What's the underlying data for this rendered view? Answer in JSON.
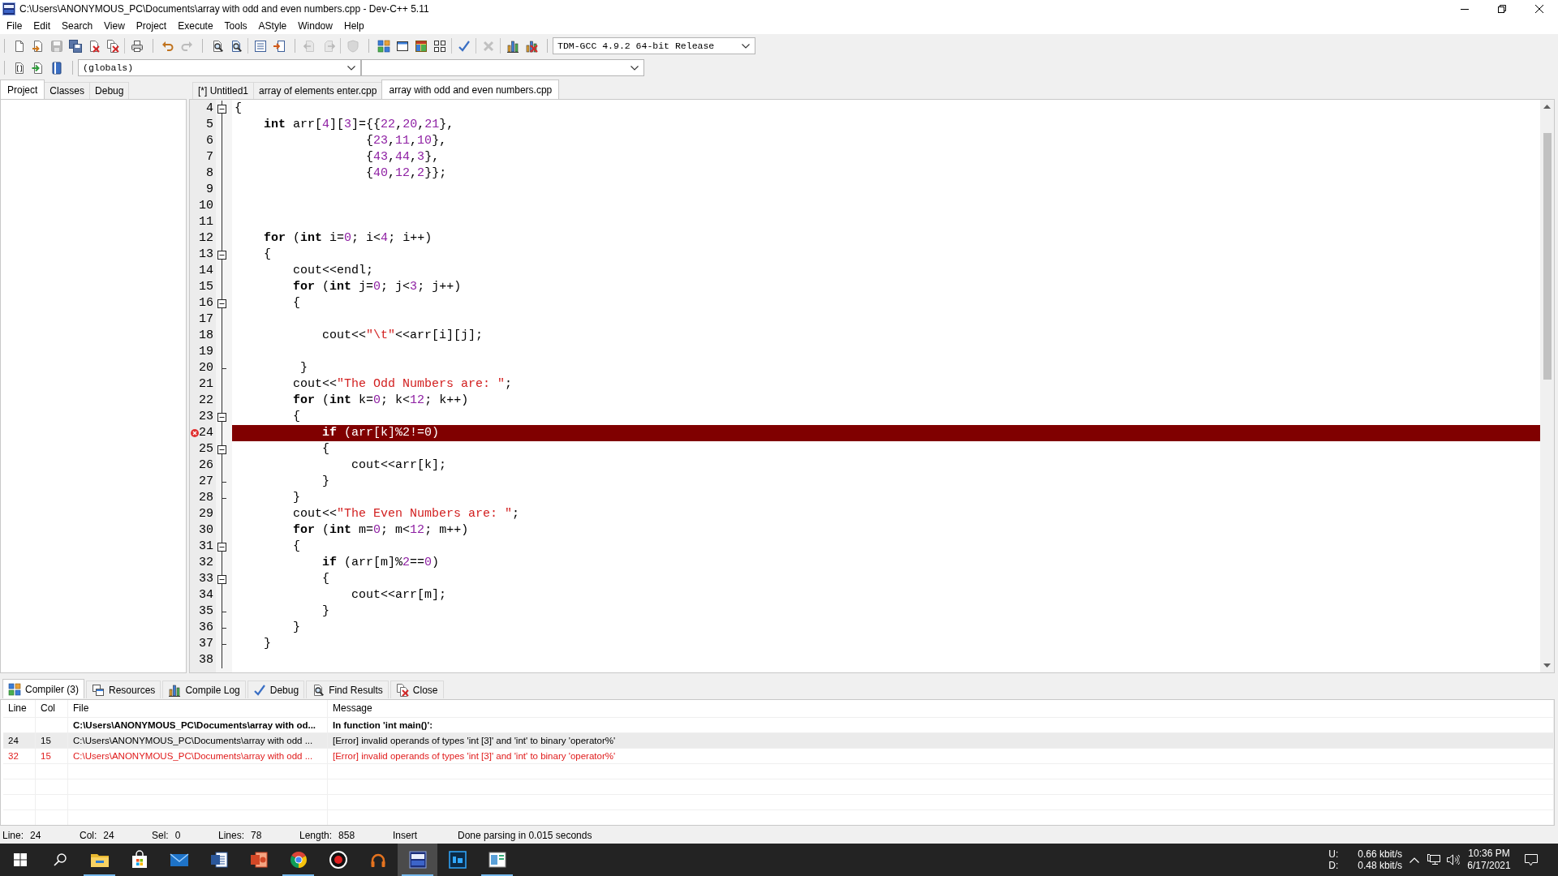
{
  "window": {
    "title": "C:\\Users\\ANONYMOUS_PC\\Documents\\array with odd and even numbers.cpp - Dev-C++ 5.11"
  },
  "menu": [
    "File",
    "Edit",
    "Search",
    "View",
    "Project",
    "Execute",
    "Tools",
    "AStyle",
    "Window",
    "Help"
  ],
  "toolbar": {
    "bands": [
      {
        "groups": [
          [
            {
              "kind": "new",
              "disabled": false
            },
            {
              "kind": "open",
              "disabled": false
            },
            {
              "kind": "save",
              "disabled": true
            },
            {
              "kind": "saveall",
              "disabled": false
            },
            {
              "kind": "close",
              "disabled": false
            },
            {
              "kind": "closeall",
              "disabled": false
            }
          ],
          [
            {
              "kind": "print",
              "disabled": false
            }
          ]
        ]
      },
      {
        "groups": [
          [
            {
              "kind": "undo",
              "disabled": false
            },
            {
              "kind": "redo",
              "disabled": true
            }
          ]
        ]
      },
      {
        "groups": [
          [
            {
              "kind": "find",
              "disabled": false
            },
            {
              "kind": "replace",
              "disabled": false
            }
          ],
          [
            {
              "kind": "panel",
              "disabled": false
            },
            {
              "kind": "panelarrow",
              "disabled": false
            }
          ]
        ]
      },
      {
        "groups": [
          [
            {
              "kind": "back",
              "disabled": true
            },
            {
              "kind": "forward",
              "disabled": true
            }
          ],
          [
            {
              "kind": "shield",
              "disabled": true
            }
          ]
        ]
      },
      {
        "groups": [
          [
            {
              "kind": "compile",
              "disabled": false
            },
            {
              "kind": "run",
              "disabled": false
            },
            {
              "kind": "compilerun",
              "disabled": false
            },
            {
              "kind": "rebuild",
              "disabled": false
            }
          ],
          [
            {
              "kind": "check",
              "disabled": false
            }
          ],
          [
            {
              "kind": "stop",
              "disabled": true
            }
          ],
          [
            {
              "kind": "profile",
              "disabled": false
            },
            {
              "kind": "deleteprofile",
              "disabled": false
            }
          ]
        ]
      }
    ],
    "compiler": "TDM-GCC 4.9.2 64-bit Release"
  },
  "classbar": {
    "buttons": [
      {
        "kind": "insertclass"
      },
      {
        "kind": "gotoclass"
      },
      {
        "kind": "bookmark"
      }
    ],
    "scope": "(globals)"
  },
  "left_panel": {
    "tabs": [
      {
        "label": "Project",
        "selected": true
      },
      {
        "label": "Classes",
        "selected": false
      },
      {
        "label": "Debug",
        "selected": false
      }
    ]
  },
  "editor": {
    "tabs": [
      {
        "label": "[*] Untitled1",
        "selected": false
      },
      {
        "label": "array of elements enter.cpp",
        "selected": false
      },
      {
        "label": "array with odd and even numbers.cpp",
        "selected": true
      }
    ],
    "lines": [
      {
        "number": "4",
        "foldable": true,
        "block_end": false,
        "error": false,
        "tokens": [
          {
            "kind": "plain",
            "text": "{"
          }
        ]
      },
      {
        "number": "5",
        "foldable": false,
        "block_end": false,
        "error": false,
        "tokens": [
          {
            "kind": "keyword",
            "text": "    int"
          },
          {
            "kind": "plain",
            "text": " arr["
          },
          {
            "kind": "number",
            "text": "4"
          },
          {
            "kind": "plain",
            "text": "]["
          },
          {
            "kind": "number",
            "text": "3"
          },
          {
            "kind": "plain",
            "text": "]={{"
          },
          {
            "kind": "number",
            "text": "22"
          },
          {
            "kind": "plain",
            "text": ","
          },
          {
            "kind": "number",
            "text": "20"
          },
          {
            "kind": "plain",
            "text": ","
          },
          {
            "kind": "number",
            "text": "21"
          },
          {
            "kind": "plain",
            "text": "},"
          }
        ]
      },
      {
        "number": "6",
        "foldable": false,
        "block_end": false,
        "error": false,
        "tokens": [
          {
            "kind": "plain",
            "text": "                  {"
          },
          {
            "kind": "number",
            "text": "23"
          },
          {
            "kind": "plain",
            "text": ","
          },
          {
            "kind": "number",
            "text": "11"
          },
          {
            "kind": "plain",
            "text": ","
          },
          {
            "kind": "number",
            "text": "10"
          },
          {
            "kind": "plain",
            "text": "},"
          }
        ]
      },
      {
        "number": "7",
        "foldable": false,
        "block_end": false,
        "error": false,
        "tokens": [
          {
            "kind": "plain",
            "text": "                  {"
          },
          {
            "kind": "number",
            "text": "43"
          },
          {
            "kind": "plain",
            "text": ","
          },
          {
            "kind": "number",
            "text": "44"
          },
          {
            "kind": "plain",
            "text": ","
          },
          {
            "kind": "number",
            "text": "3"
          },
          {
            "kind": "plain",
            "text": "},"
          }
        ]
      },
      {
        "number": "8",
        "foldable": false,
        "block_end": false,
        "error": false,
        "tokens": [
          {
            "kind": "plain",
            "text": "                  {"
          },
          {
            "kind": "number",
            "text": "40"
          },
          {
            "kind": "plain",
            "text": ","
          },
          {
            "kind": "number",
            "text": "12"
          },
          {
            "kind": "plain",
            "text": ","
          },
          {
            "kind": "number",
            "text": "2"
          },
          {
            "kind": "plain",
            "text": "}};"
          }
        ]
      },
      {
        "number": "9",
        "foldable": false,
        "block_end": false,
        "error": false
      },
      {
        "number": "10",
        "foldable": false,
        "block_end": false,
        "error": false
      },
      {
        "number": "11",
        "foldable": false,
        "block_end": false,
        "error": false
      },
      {
        "number": "12",
        "foldable": false,
        "block_end": false,
        "error": false,
        "tokens": [
          {
            "kind": "keyword",
            "text": "    for"
          },
          {
            "kind": "plain",
            "text": " ("
          },
          {
            "kind": "keyword",
            "text": "int"
          },
          {
            "kind": "plain",
            "text": " i="
          },
          {
            "kind": "number",
            "text": "0"
          },
          {
            "kind": "plain",
            "text": "; i<"
          },
          {
            "kind": "number",
            "text": "4"
          },
          {
            "kind": "plain",
            "text": "; i++)"
          }
        ]
      },
      {
        "number": "13",
        "foldable": true,
        "block_end": false,
        "error": false,
        "tokens": [
          {
            "kind": "plain",
            "text": "    {"
          }
        ]
      },
      {
        "number": "14",
        "foldable": false,
        "block_end": false,
        "error": false,
        "tokens": [
          {
            "kind": "plain",
            "text": "        cout<<endl;"
          }
        ]
      },
      {
        "number": "15",
        "foldable": false,
        "block_end": false,
        "error": false,
        "tokens": [
          {
            "kind": "keyword",
            "text": "        for"
          },
          {
            "kind": "plain",
            "text": " ("
          },
          {
            "kind": "keyword",
            "text": "int"
          },
          {
            "kind": "plain",
            "text": " j="
          },
          {
            "kind": "number",
            "text": "0"
          },
          {
            "kind": "plain",
            "text": "; j<"
          },
          {
            "kind": "number",
            "text": "3"
          },
          {
            "kind": "plain",
            "text": "; j++)"
          }
        ]
      },
      {
        "number": "16",
        "foldable": true,
        "block_end": false,
        "error": false,
        "tokens": [
          {
            "kind": "plain",
            "text": "        {"
          }
        ]
      },
      {
        "number": "17",
        "foldable": false,
        "block_end": false,
        "error": false
      },
      {
        "number": "18",
        "foldable": false,
        "block_end": false,
        "error": false,
        "tokens": [
          {
            "kind": "plain",
            "text": "            cout<<"
          },
          {
            "kind": "string",
            "text": "\"\\t\""
          },
          {
            "kind": "plain",
            "text": "<<arr[i][j];"
          }
        ]
      },
      {
        "number": "19",
        "foldable": false,
        "block_end": false,
        "error": false
      },
      {
        "number": "20",
        "foldable": false,
        "block_end": true,
        "error": false,
        "tokens": [
          {
            "kind": "plain",
            "text": "         }"
          }
        ]
      },
      {
        "number": "21",
        "foldable": false,
        "block_end": false,
        "error": false,
        "tokens": [
          {
            "kind": "plain",
            "text": "        cout<<"
          },
          {
            "kind": "string",
            "text": "\"The Odd Numbers are: \""
          },
          {
            "kind": "plain",
            "text": ";"
          }
        ]
      },
      {
        "number": "22",
        "foldable": false,
        "block_end": false,
        "error": false,
        "tokens": [
          {
            "kind": "keyword",
            "text": "        for"
          },
          {
            "kind": "plain",
            "text": " ("
          },
          {
            "kind": "keyword",
            "text": "int"
          },
          {
            "kind": "plain",
            "text": " k="
          },
          {
            "kind": "number",
            "text": "0"
          },
          {
            "kind": "plain",
            "text": "; k<"
          },
          {
            "kind": "number",
            "text": "12"
          },
          {
            "kind": "plain",
            "text": "; k++)"
          }
        ]
      },
      {
        "number": "23",
        "foldable": true,
        "block_end": false,
        "error": false,
        "tokens": [
          {
            "kind": "plain",
            "text": "        {"
          }
        ]
      },
      {
        "number": "24",
        "foldable": false,
        "block_end": false,
        "error": true,
        "tokens": [
          {
            "kind": "keyword",
            "text": "            if"
          },
          {
            "kind": "plain",
            "text": " (arr[k]%"
          },
          {
            "kind": "number",
            "text": "2"
          },
          {
            "kind": "plain",
            "text": "!="
          },
          {
            "kind": "number",
            "text": "0"
          },
          {
            "kind": "plain",
            "text": ")"
          }
        ]
      },
      {
        "number": "25",
        "foldable": true,
        "block_end": false,
        "error": false,
        "tokens": [
          {
            "kind": "plain",
            "text": "            {"
          }
        ]
      },
      {
        "number": "26",
        "foldable": false,
        "block_end": false,
        "error": false,
        "tokens": [
          {
            "kind": "plain",
            "text": "                cout<<arr[k];"
          }
        ]
      },
      {
        "number": "27",
        "foldable": false,
        "block_end": true,
        "error": false,
        "tokens": [
          {
            "kind": "plain",
            "text": "            }"
          }
        ]
      },
      {
        "number": "28",
        "foldable": false,
        "block_end": true,
        "error": false,
        "tokens": [
          {
            "kind": "plain",
            "text": "        }"
          }
        ]
      },
      {
        "number": "29",
        "foldable": false,
        "block_end": false,
        "error": false,
        "tokens": [
          {
            "kind": "plain",
            "text": "        cout<<"
          },
          {
            "kind": "string",
            "text": "\"The Even Numbers are: \""
          },
          {
            "kind": "plain",
            "text": ";"
          }
        ]
      },
      {
        "number": "30",
        "foldable": false,
        "block_end": false,
        "error": false,
        "tokens": [
          {
            "kind": "keyword",
            "text": "        for"
          },
          {
            "kind": "plain",
            "text": " ("
          },
          {
            "kind": "keyword",
            "text": "int"
          },
          {
            "kind": "plain",
            "text": " m="
          },
          {
            "kind": "number",
            "text": "0"
          },
          {
            "kind": "plain",
            "text": "; m<"
          },
          {
            "kind": "number",
            "text": "12"
          },
          {
            "kind": "plain",
            "text": "; m++)"
          }
        ]
      },
      {
        "number": "31",
        "foldable": true,
        "block_end": false,
        "error": false,
        "tokens": [
          {
            "kind": "plain",
            "text": "        {"
          }
        ]
      },
      {
        "number": "32",
        "foldable": false,
        "block_end": false,
        "error": false,
        "tokens": [
          {
            "kind": "keyword",
            "text": "            if"
          },
          {
            "kind": "plain",
            "text": " (arr[m]%"
          },
          {
            "kind": "number",
            "text": "2"
          },
          {
            "kind": "plain",
            "text": "=="
          },
          {
            "kind": "number",
            "text": "0"
          },
          {
            "kind": "plain",
            "text": ")"
          }
        ]
      },
      {
        "number": "33",
        "foldable": true,
        "block_end": false,
        "error": false,
        "tokens": [
          {
            "kind": "plain",
            "text": "            {"
          }
        ]
      },
      {
        "number": "34",
        "foldable": false,
        "block_end": false,
        "error": false,
        "tokens": [
          {
            "kind": "plain",
            "text": "                cout<<arr[m];"
          }
        ]
      },
      {
        "number": "35",
        "foldable": false,
        "block_end": true,
        "error": false,
        "tokens": [
          {
            "kind": "plain",
            "text": "            }"
          }
        ]
      },
      {
        "number": "36",
        "foldable": false,
        "block_end": true,
        "error": false,
        "tokens": [
          {
            "kind": "plain",
            "text": "        }"
          }
        ]
      },
      {
        "number": "37",
        "foldable": false,
        "block_end": true,
        "error": false,
        "tokens": [
          {
            "kind": "plain",
            "text": "    }"
          }
        ]
      },
      {
        "number": "38",
        "foldable": false,
        "block_end": false,
        "error": false
      }
    ]
  },
  "bottom_panel": {
    "tabs": [
      {
        "label": "Compiler (3)",
        "kind": "compiler",
        "selected": true
      },
      {
        "label": "Resources",
        "kind": "resources",
        "selected": false
      },
      {
        "label": "Compile Log",
        "kind": "log",
        "selected": false
      },
      {
        "label": "Debug",
        "kind": "debug",
        "selected": false
      },
      {
        "label": "Find Results",
        "kind": "find",
        "selected": false
      },
      {
        "label": "Close",
        "kind": "close",
        "selected": false
      }
    ],
    "table": {
      "columns": [
        "Line",
        "Col",
        "File",
        "Message"
      ],
      "rows": [
        {
          "kind": "heading",
          "selected": false,
          "file": "C:\\Users\\ANONYMOUS_PC\\Documents\\array with od...",
          "message": "In function 'int main()':"
        },
        {
          "kind": "error",
          "selected": true,
          "line": "24",
          "col": "15",
          "file": "C:\\Users\\ANONYMOUS_PC\\Documents\\array with odd ...",
          "message": "[Error] invalid operands of types 'int [3]' and 'int' to binary 'operator%'"
        },
        {
          "kind": "error",
          "selected": false,
          "line": "32",
          "col": "15",
          "file": "C:\\Users\\ANONYMOUS_PC\\Documents\\array with odd ...",
          "message": "[Error] invalid operands of types 'int [3]' and 'int' to binary 'operator%'"
        }
      ]
    }
  },
  "status_bar": {
    "fields": [
      {
        "label": "Line:",
        "value": "24"
      },
      {
        "label": "Col:",
        "value": "24"
      },
      {
        "label": "Sel:",
        "value": "0"
      },
      {
        "label": "Lines:",
        "value": "78"
      },
      {
        "label": "Length:",
        "value": "858"
      }
    ],
    "mode": "Insert",
    "message": "Done parsing in 0.015 seconds"
  },
  "taskbar": {
    "apps": [
      {
        "kind": "start",
        "running": false,
        "active": false
      },
      {
        "kind": "search",
        "running": false,
        "active": false
      },
      {
        "kind": "files",
        "running": true,
        "active": false
      },
      {
        "kind": "store",
        "running": false,
        "active": false
      },
      {
        "kind": "mail",
        "running": false,
        "active": false
      },
      {
        "kind": "writer",
        "running": false,
        "active": false
      },
      {
        "kind": "slides",
        "running": false,
        "active": false
      },
      {
        "kind": "browser",
        "running": true,
        "active": false
      },
      {
        "kind": "recorder",
        "running": false,
        "active": false
      },
      {
        "kind": "headphones",
        "running": false,
        "active": false
      },
      {
        "kind": "ide",
        "running": true,
        "active": true
      },
      {
        "kind": "imaging",
        "running": false,
        "active": false
      },
      {
        "kind": "viewer",
        "running": true,
        "active": false
      }
    ],
    "tray": {
      "network": [
        {
          "label": "U:",
          "rate": "0.66 kbit/s"
        },
        {
          "label": "D:",
          "rate": "0.48 kbit/s"
        }
      ],
      "time": "10:36 PM",
      "date": "6/17/2021"
    }
  }
}
